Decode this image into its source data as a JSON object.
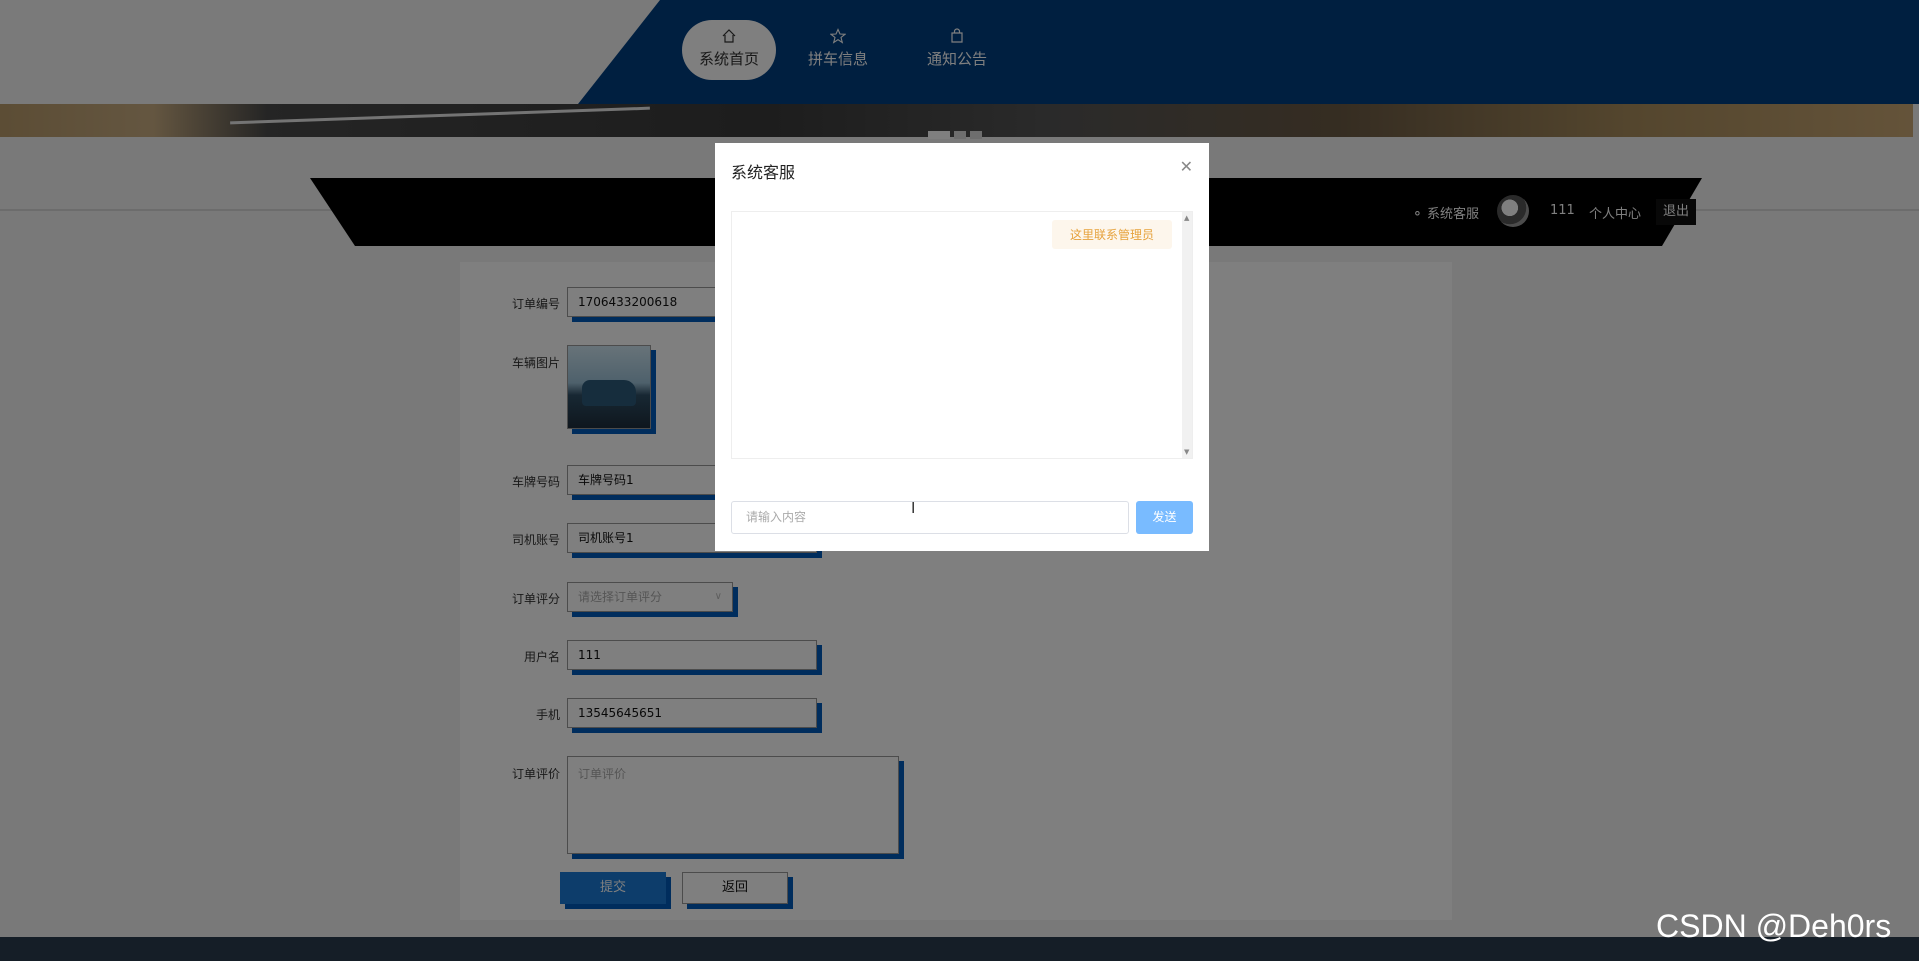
{
  "nav": {
    "items": [
      {
        "label": "系统首页",
        "icon": "home-icon",
        "active": true
      },
      {
        "label": "拼车信息",
        "icon": "star-icon",
        "active": false
      },
      {
        "label": "通知公告",
        "icon": "bag-icon",
        "active": false
      }
    ]
  },
  "userbar": {
    "service_label": "系统客服",
    "username": "111",
    "profile_label": "个人中心",
    "logout_label": "退出"
  },
  "form": {
    "order_no_label": "订单编号",
    "order_no_value": "1706433200618",
    "car_image_label": "车辆图片",
    "plate_label": "车牌号码",
    "plate_value": "车牌号码1",
    "driver_label": "司机账号",
    "driver_value": "司机账号1",
    "rating_label": "订单评分",
    "rating_placeholder": "请选择订单评分",
    "username_label": "用户名",
    "username_value": "111",
    "phone_label": "手机",
    "phone_value": "13545645651",
    "review_label": "订单评价",
    "review_placeholder": "订单评价",
    "submit_label": "提交",
    "back_label": "返回"
  },
  "modal": {
    "title": "系统客服",
    "message": "这里联系管理员",
    "input_placeholder": "请输入内容",
    "send_label": "发送"
  },
  "watermark": "CSDN @Deh0rs"
}
